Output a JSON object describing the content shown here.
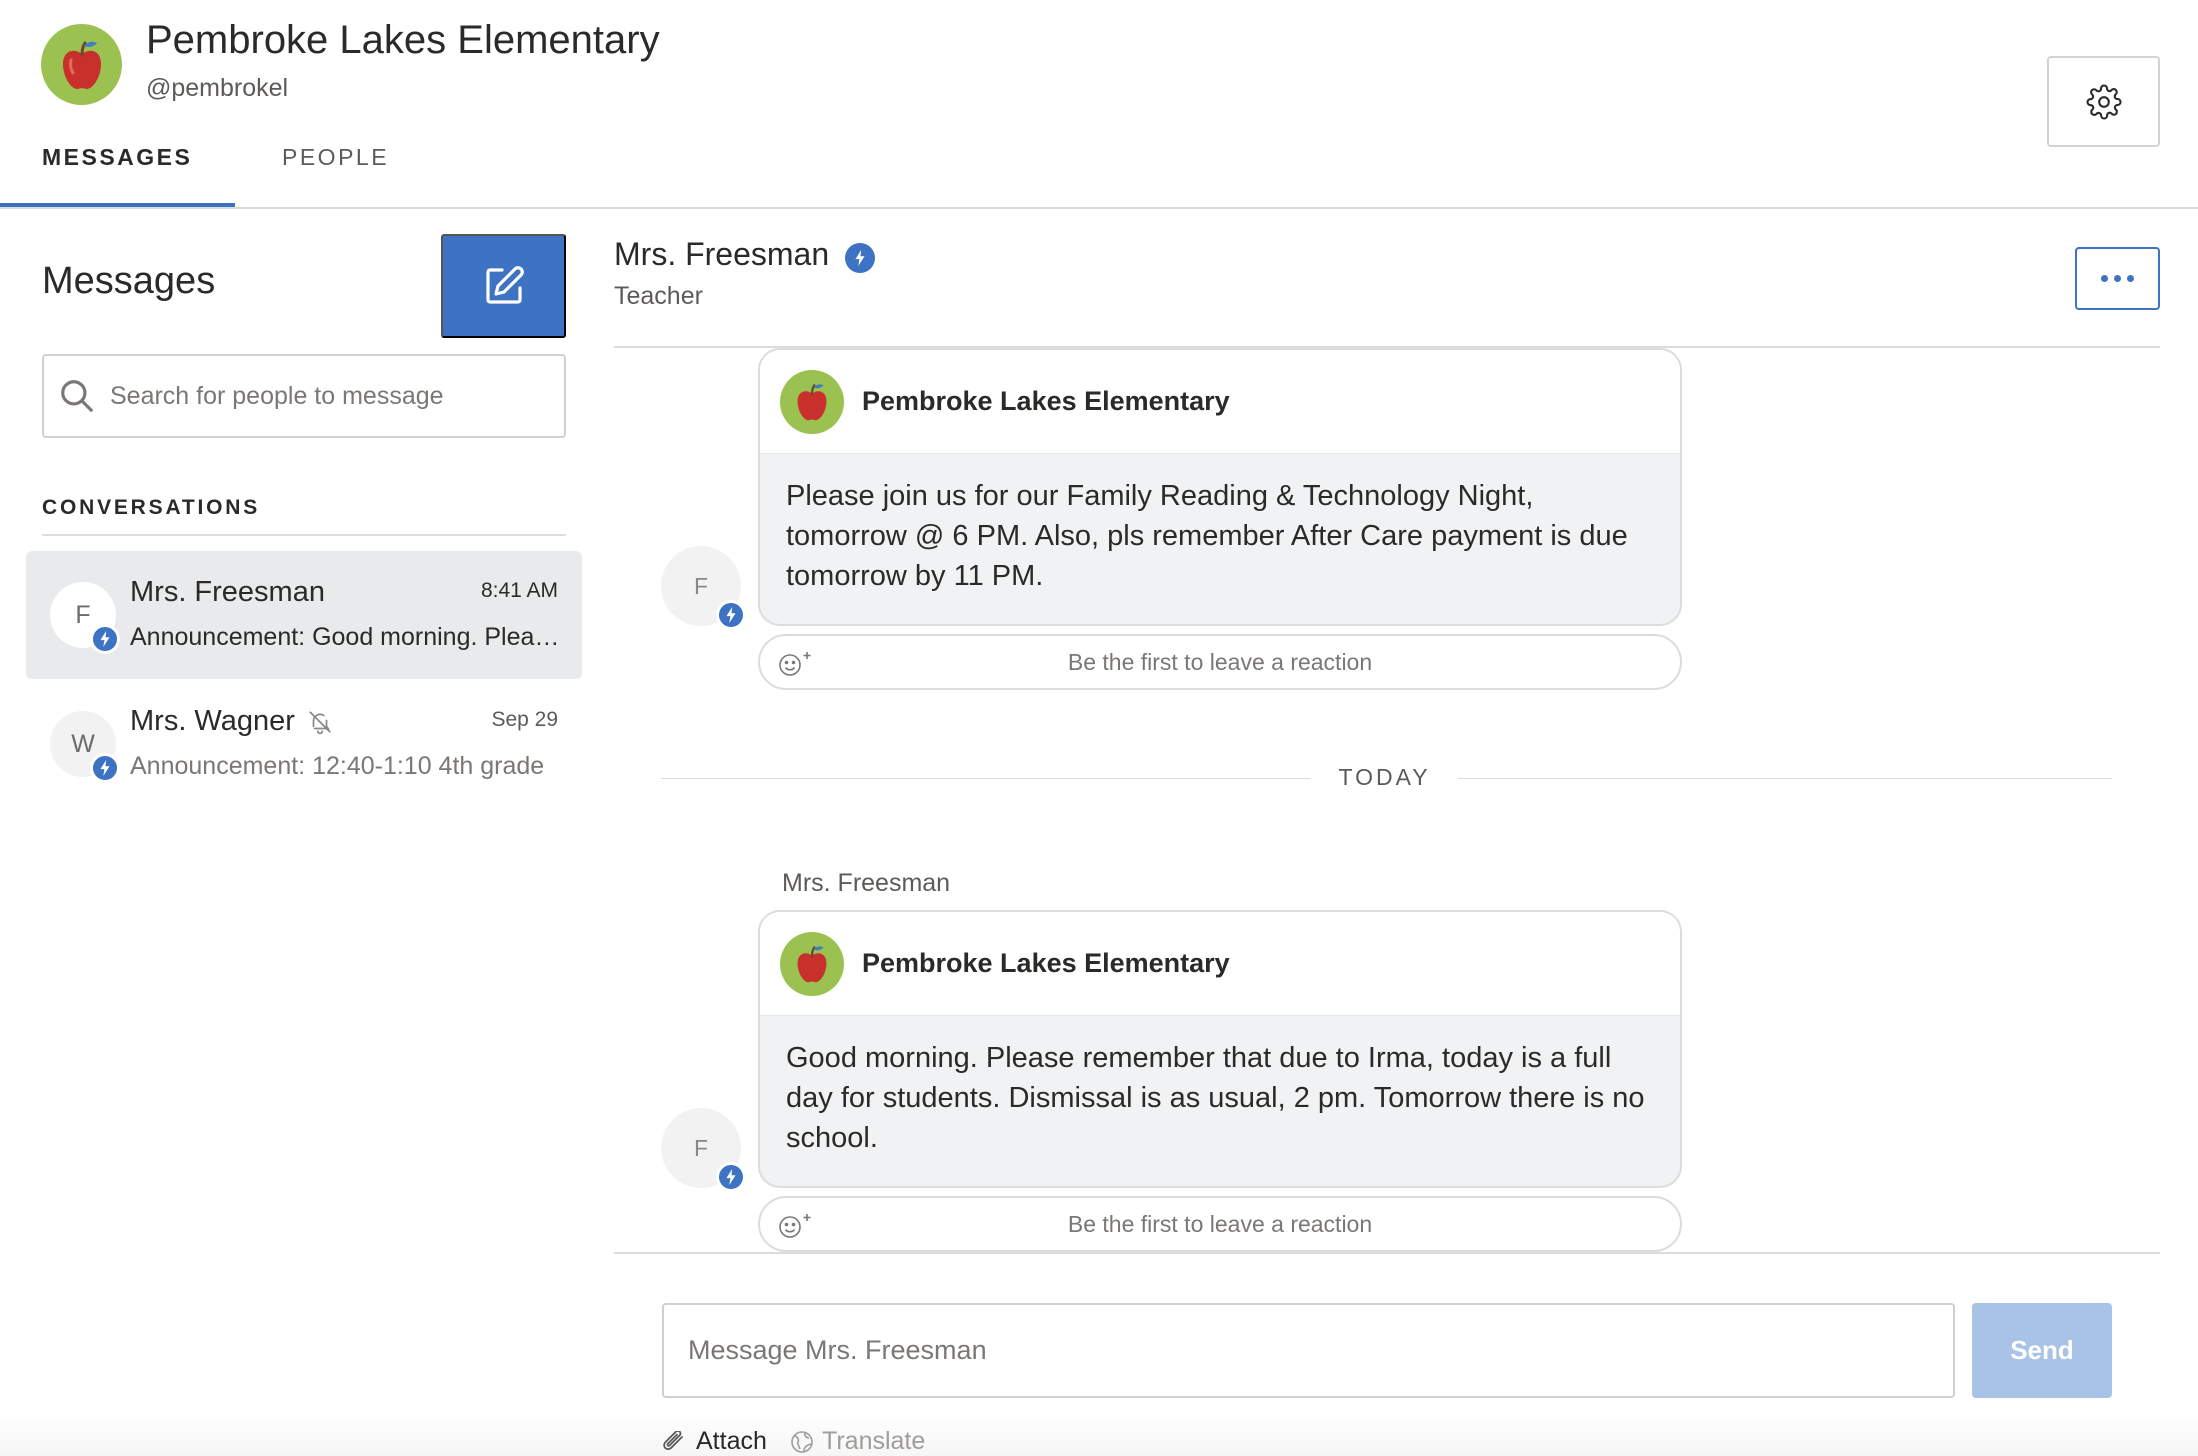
{
  "header": {
    "school_name": "Pembroke Lakes Elementary",
    "handle": "@pembrokel",
    "tabs": [
      {
        "label": "MESSAGES",
        "active": true
      },
      {
        "label": "PEOPLE",
        "active": false
      }
    ]
  },
  "sidebar": {
    "title": "Messages",
    "search_placeholder": "Search for people to message",
    "conversations_heading": "CONVERSATIONS",
    "conversations": [
      {
        "initial": "F",
        "name": "Mrs. Freesman",
        "time": "8:41 AM",
        "preview": "Announcement: Good morning. Please remember that due to Irma, today is a full day for students.",
        "active": true
      },
      {
        "initial": "W",
        "name": "Mrs. Wagner",
        "time": "Sep 29",
        "preview": "Announcement: 12:40-1:10 4th grade",
        "active": false,
        "muted": true
      }
    ]
  },
  "chat": {
    "name": "Mrs. Freesman",
    "role": "Teacher",
    "today_label": "TODAY",
    "messages": [
      {
        "sender_initial": "F",
        "card_title": "Pembroke Lakes Elementary",
        "body": "Please join us for our Family Reading & Technology Night, tomorrow @ 6 PM. Also, pls remember After Care payment is due tomorrow by 11 PM.",
        "reaction_prompt": "Be the first to leave a reaction"
      },
      {
        "sender_label": "Mrs. Freesman",
        "sender_initial": "F",
        "card_title": "Pembroke Lakes Elementary",
        "body": "Good morning. Please remember that due to Irma, today is a full day for students. Dismissal is as usual, 2 pm. Tomorrow there is no school.",
        "reaction_prompt": "Be the first to leave a reaction"
      }
    ]
  },
  "composer": {
    "placeholder": "Message Mrs. Freesman",
    "send_label": "Send",
    "attach_label": "Attach",
    "translate_label": "Translate"
  },
  "colors": {
    "accent": "#3d73c2",
    "avatar_green": "#9bc250",
    "send_disabled": "#a9c3e7"
  },
  "icons": {
    "settings": "gear-icon",
    "compose": "compose-icon",
    "search": "search-icon",
    "more": "more-icon",
    "verified": "lightning-badge-icon",
    "mute": "mute-bell-icon",
    "reaction": "add-reaction-icon",
    "attach": "paperclip-icon",
    "translate": "globe-icon",
    "school_logo": "apple-icon"
  }
}
